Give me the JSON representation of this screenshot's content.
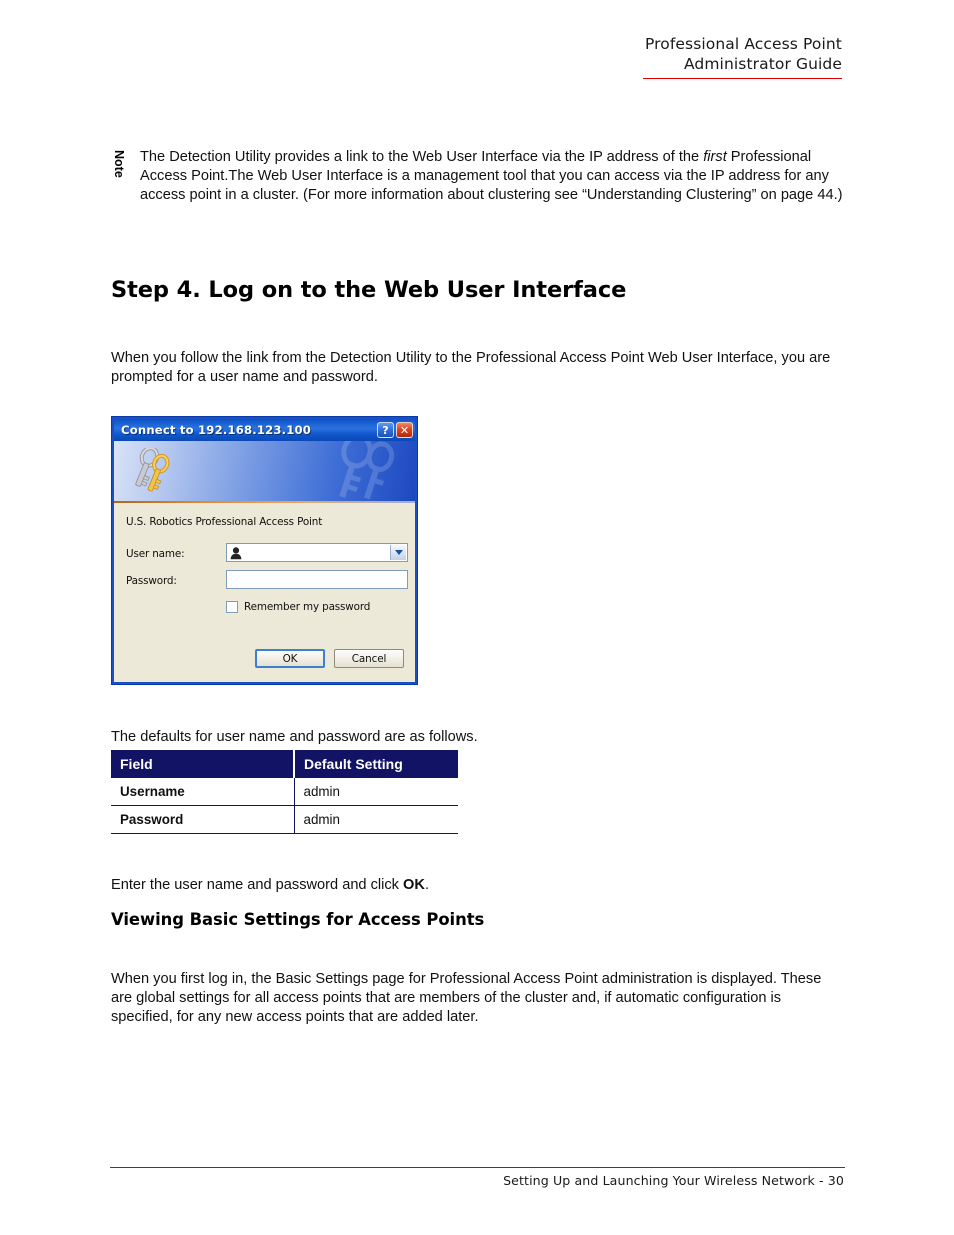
{
  "header": {
    "line1": "Professional Access Point",
    "line2": "Administrator Guide",
    "rule_color": "#e00000"
  },
  "note": {
    "label": "Note",
    "text_part1": "The Detection Utility provides a link to the Web User Interface via the IP address of the ",
    "text_italic": "first",
    "text_part2": " Professional Access Point.The Web User Interface is a management tool that you can access via the IP address for any access point in a cluster. (For more information about clustering see “Understanding Clustering” on page 44.)"
  },
  "step_heading": "Step 4. Log on to the Web User Interface",
  "paragraphs": {
    "intro": "When you follow the link from the Detection Utility to the Professional Access Point Web User Interface, you are prompted for a user name and password.",
    "defaults_intro": "The defaults for user name and password are as follows.",
    "enter_prefix": "Enter the user name and password and click ",
    "enter_bold": "OK",
    "enter_suffix": ".",
    "basic_settings": "When you first log in, the Basic Settings page for Professional Access Point administration is displayed. These are global settings for all access points that are members of the cluster and, if automatic configuration is specified, for any new access points that are added later."
  },
  "dialog": {
    "title": "Connect to 192.168.123.100",
    "help_button": "?",
    "close_button": "✕",
    "realm": "U.S. Robotics Professional Access Point",
    "username_label": "User name:",
    "username_value": "",
    "password_label": "Password:",
    "password_value": "",
    "remember_label": "Remember my password",
    "ok_button": "OK",
    "cancel_button": "Cancel",
    "titlebar_color": "#1157cc",
    "body_color": "#ece9d8"
  },
  "table": {
    "headers": [
      "Field",
      "Default Setting"
    ],
    "rows": [
      [
        "Username",
        "admin"
      ],
      [
        "Password",
        "admin"
      ]
    ],
    "header_bg": "#131366"
  },
  "footer": {
    "text": "Setting Up and Launching Your Wireless Network - 30",
    "rule_color": "#e00000"
  }
}
